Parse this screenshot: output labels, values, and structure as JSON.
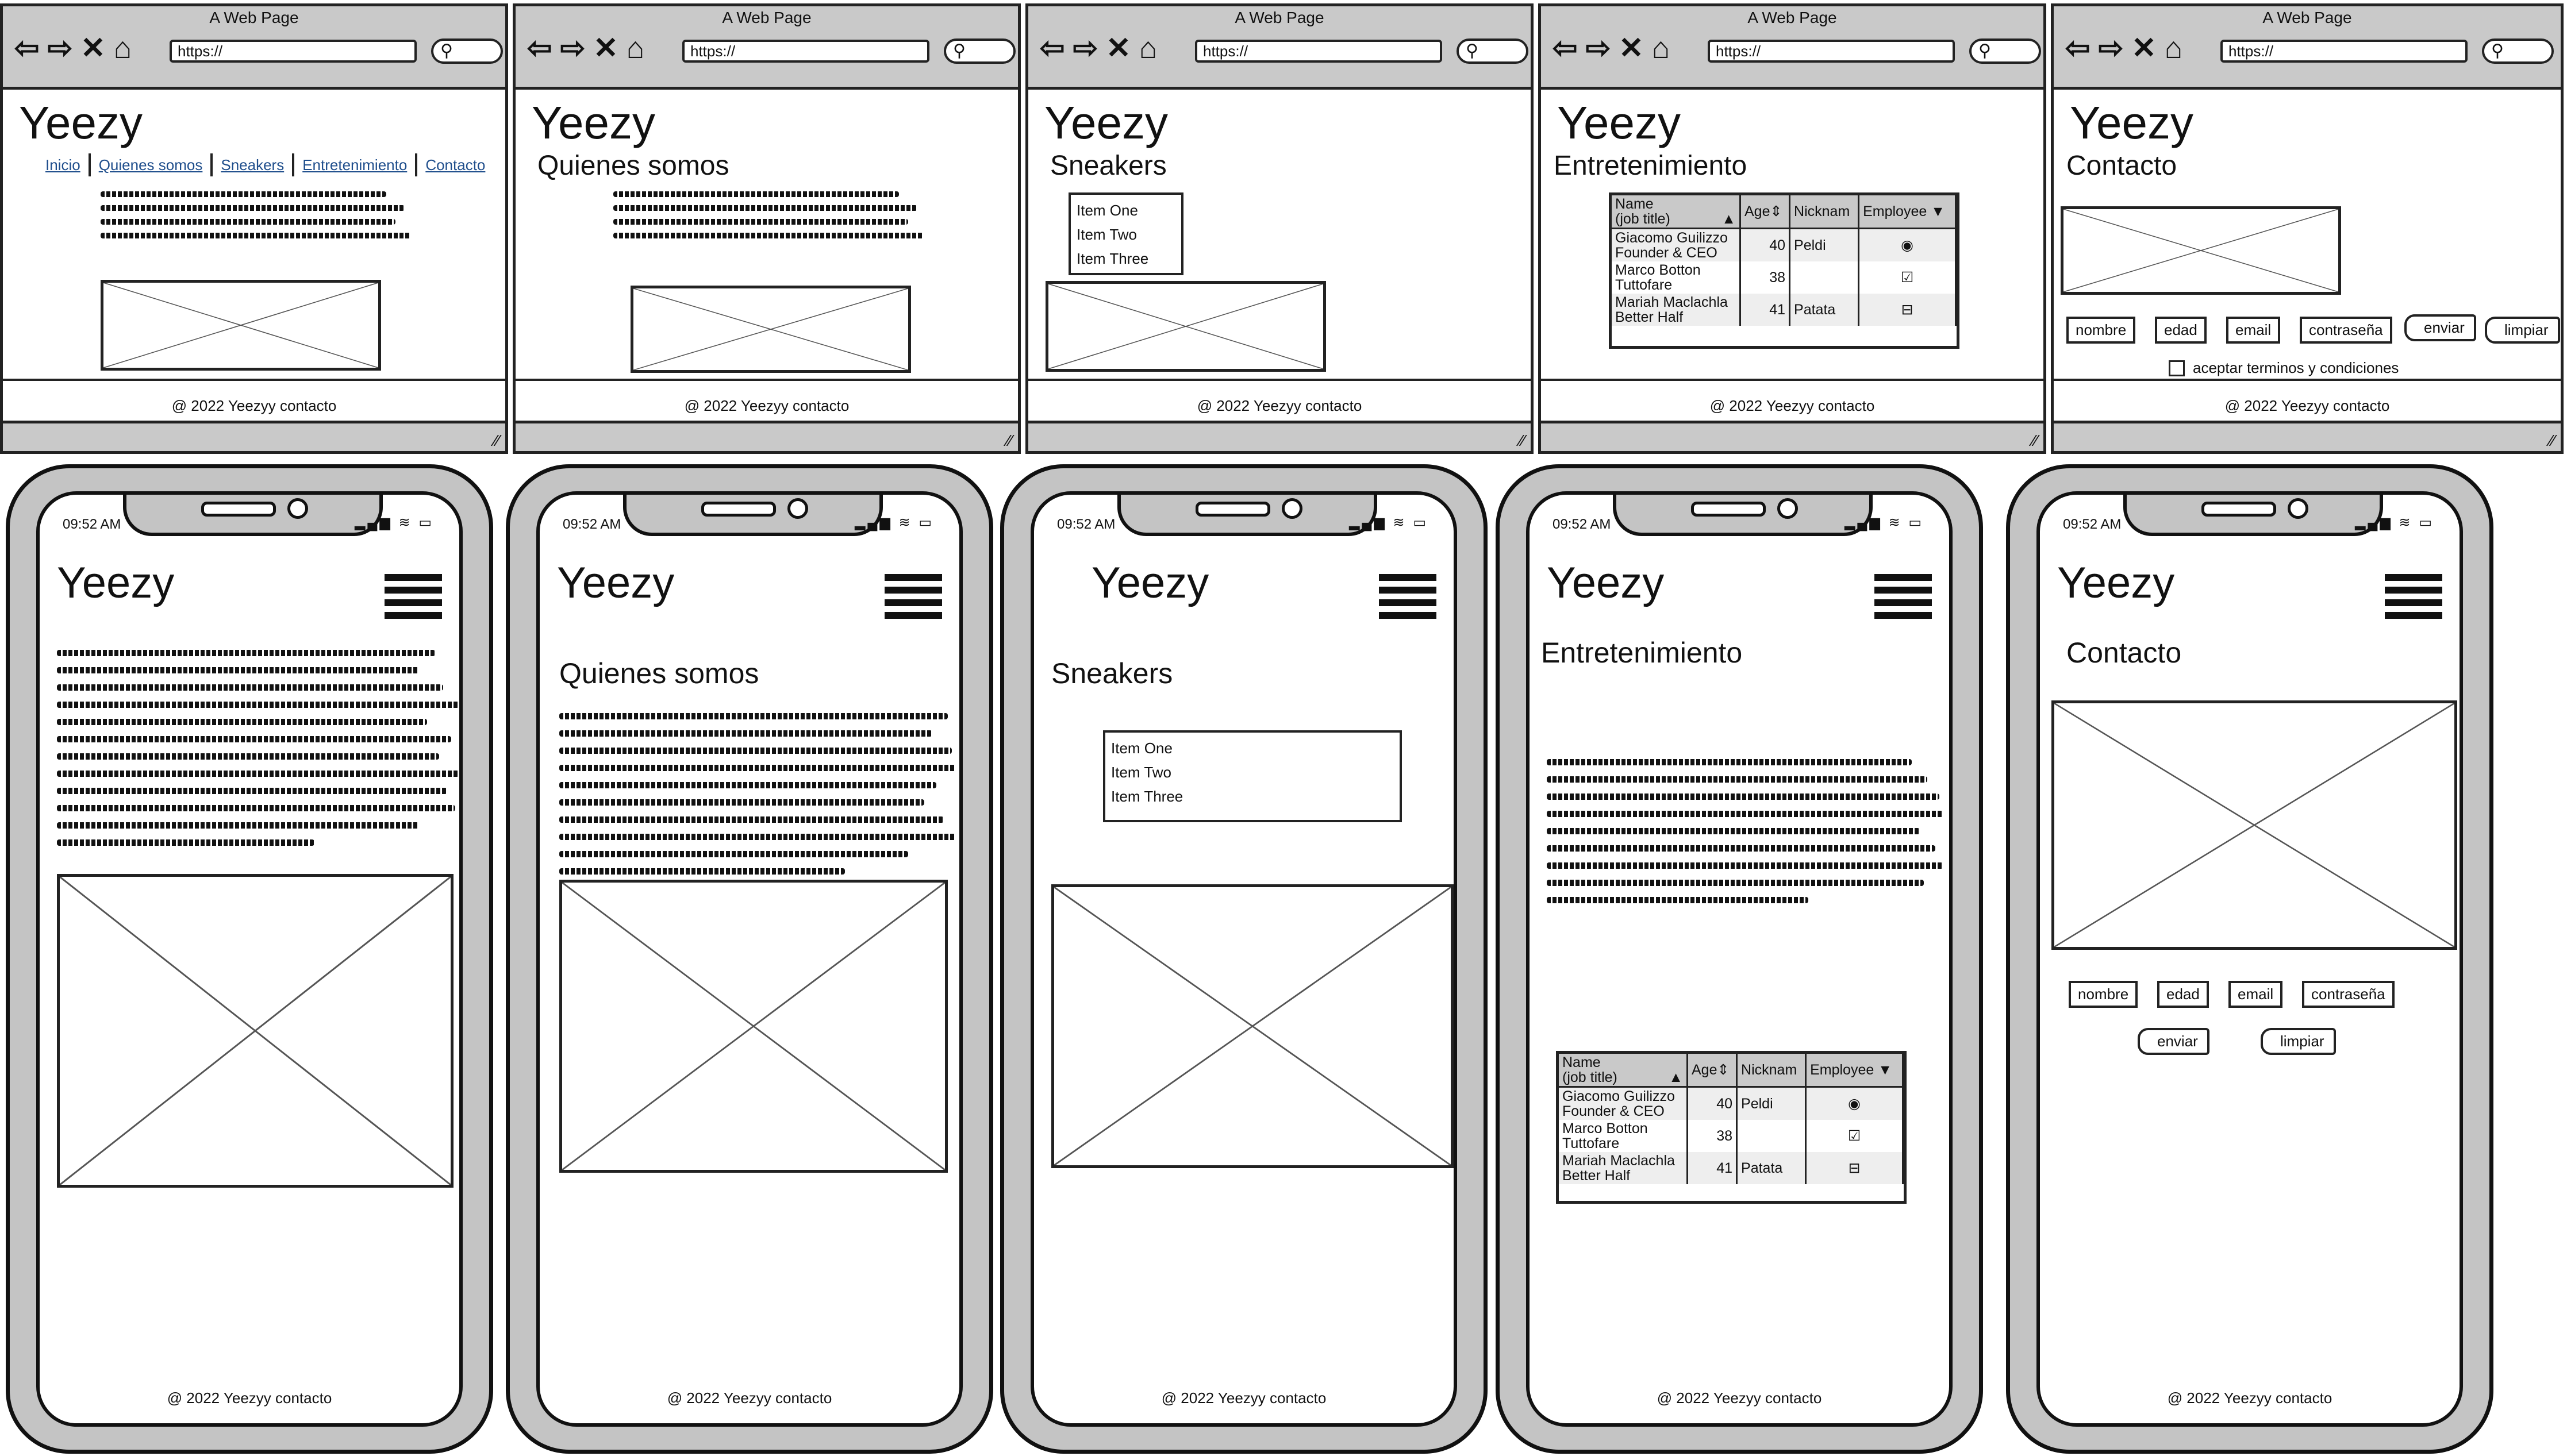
{
  "browser": {
    "window_title": "A Web Page",
    "url": "https://",
    "search_icon": "search-icon"
  },
  "brand": "Yeezy",
  "footer": "@ 2022 Yeezyy contacto",
  "time": "09:52 AM",
  "nav": [
    "Inicio",
    "Quienes somos",
    "Sneakers",
    "Entretenimiento",
    "Contacto"
  ],
  "pages": {
    "quienes": "Quienes somos",
    "sneakers": "Sneakers",
    "entretenimiento": "Entretenimiento",
    "contacto": "Contacto"
  },
  "list_items": [
    "Item One",
    "Item Two",
    "Item Three"
  ],
  "table": {
    "headers": [
      "Name\n(job title)",
      "Age",
      "Nicknam",
      "Employee"
    ],
    "rows": [
      {
        "name": "Giacomo Guilizzo",
        "title": "Founder & CEO",
        "age": "40",
        "nick": "Peldi",
        "employee": "radio"
      },
      {
        "name": "Marco Botton",
        "title": "Tuttofare",
        "age": "38",
        "nick": "",
        "employee": "checkbox"
      },
      {
        "name": "Mariah Maclachla",
        "title": "Better Half",
        "age": "41",
        "nick": "Patata",
        "employee": "indeterminate"
      }
    ]
  },
  "form": {
    "fields": [
      "nombre",
      "edad",
      "email",
      "contraseña"
    ],
    "submit": "enviar",
    "reset": "limpiar",
    "terms": "aceptar terminos y condiciones"
  }
}
